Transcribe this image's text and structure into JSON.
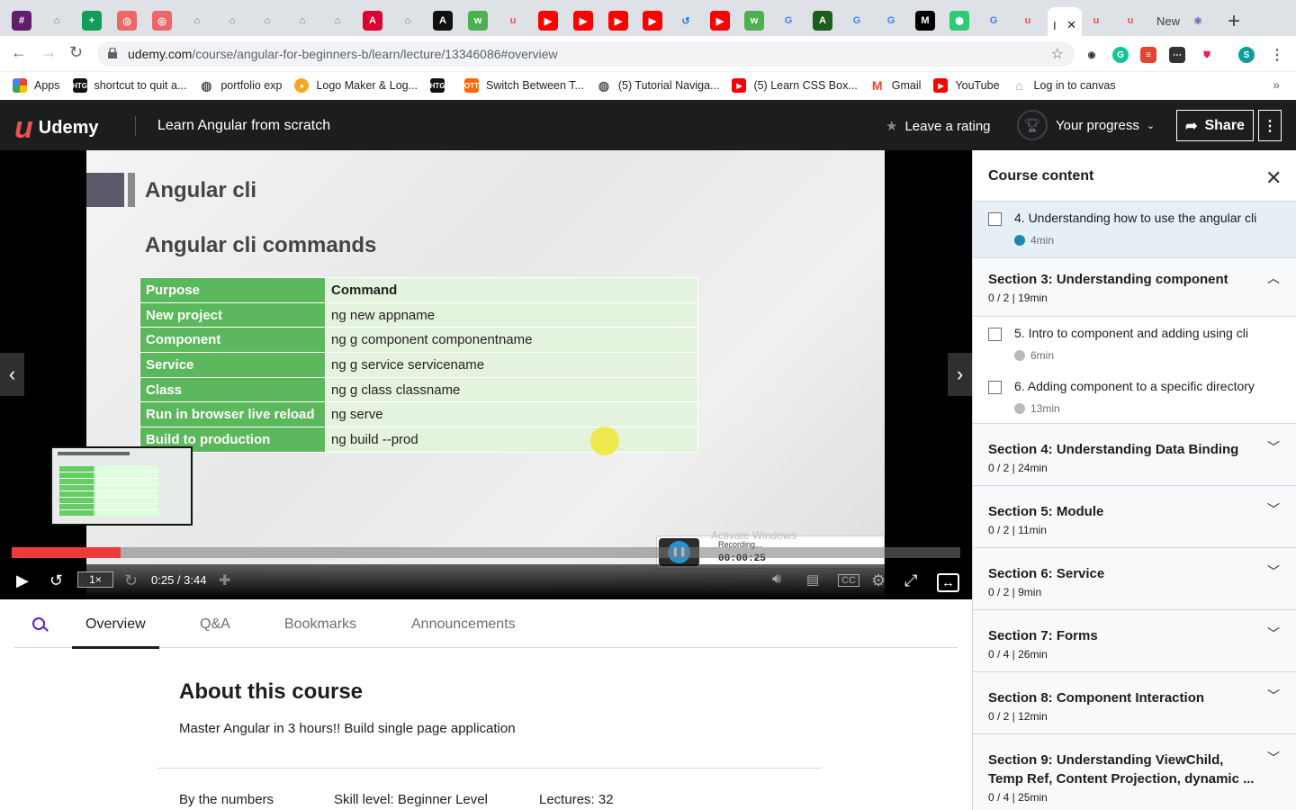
{
  "browser": {
    "active_tab_title": "I",
    "new_tab_label": "New",
    "url_host": "udemy.com",
    "url_path": "/course/angular-for-beginners-b/learn/lecture/13346086#overview",
    "profile_initial": "S"
  },
  "bookmarks": [
    {
      "label": "Apps",
      "icon": "apps-grid-icon"
    },
    {
      "label": "shortcut to quit a...",
      "icon": "htg-icon"
    },
    {
      "label": "portfolio exp",
      "icon": "globe-icon"
    },
    {
      "label": "Logo Maker & Log...",
      "icon": "logo-maker-icon"
    },
    {
      "label": "HTG",
      "icon": "htg-icon"
    },
    {
      "label": "Switch Between T...",
      "icon": "ott-icon"
    },
    {
      "label": "(5) Tutorial Naviga...",
      "icon": "globe-icon"
    },
    {
      "label": "(5) Learn CSS Box...",
      "icon": "youtube-icon"
    },
    {
      "label": "Gmail",
      "icon": "gmail-icon"
    },
    {
      "label": "YouTube",
      "icon": "youtube-icon"
    },
    {
      "label": "Log in to canvas",
      "icon": "canvas-icon"
    }
  ],
  "header": {
    "brand": "Udemy",
    "course_title": "Learn Angular from scratch",
    "rating_label": "Leave a rating",
    "progress_label": "Your progress",
    "share_label": "Share"
  },
  "slide": {
    "heading": "Angular cli",
    "subheading": "Angular cli commands",
    "rows": [
      {
        "purpose": "Purpose",
        "command": "Command"
      },
      {
        "purpose": "New project",
        "command": "ng new appname"
      },
      {
        "purpose": "Component",
        "command": "ng g component componentname"
      },
      {
        "purpose": "Service",
        "command": "ng g service servicename"
      },
      {
        "purpose": "Class",
        "command": "ng g class classname"
      },
      {
        "purpose": "Run in browser live reload",
        "command": "ng serve"
      },
      {
        "purpose": "Build to production",
        "command": "ng build --prod"
      }
    ]
  },
  "player": {
    "speed": "1×",
    "time": "0:25 / 3:44",
    "progress_fraction": 0.115,
    "recording_label": "Recording...",
    "recording_time": "00:00:25",
    "watermark": "Activate Windows"
  },
  "tabs": [
    {
      "label": "Overview",
      "active": true
    },
    {
      "label": "Q&A",
      "active": false
    },
    {
      "label": "Bookmarks",
      "active": false
    },
    {
      "label": "Announcements",
      "active": false
    }
  ],
  "about": {
    "title": "About this course",
    "description": "Master Angular in 3 hours!! Build single page application",
    "by_numbers": "By the numbers",
    "skill_level": "Skill level: Beginner Level",
    "lectures": "Lectures: 32"
  },
  "sidebar": {
    "title": "Course content",
    "current_lecture": {
      "title": "4. Understanding how to use the angular cli",
      "duration": "4min"
    },
    "sections": [
      {
        "title": "Section 3: Understanding component",
        "meta": "0 / 2 | 19min",
        "expanded": true,
        "lectures": [
          {
            "title": "5. Intro to component and adding using cli",
            "duration": "6min"
          },
          {
            "title": "6. Adding component to a specific directory",
            "duration": "13min"
          }
        ]
      },
      {
        "title": "Section 4: Understanding Data Binding",
        "meta": "0 / 2 | 24min"
      },
      {
        "title": "Section 5: Module",
        "meta": "0 / 2 | 11min"
      },
      {
        "title": "Section 6: Service",
        "meta": "0 / 2 | 9min"
      },
      {
        "title": "Section 7: Forms",
        "meta": "0 / 4 | 26min"
      },
      {
        "title": "Section 8: Component Interaction",
        "meta": "0 / 2 | 12min"
      },
      {
        "title": "Section 9: Understanding ViewChild, Temp Ref, Content Projection, dynamic ...",
        "meta": "0 / 4 | 25min"
      }
    ]
  }
}
